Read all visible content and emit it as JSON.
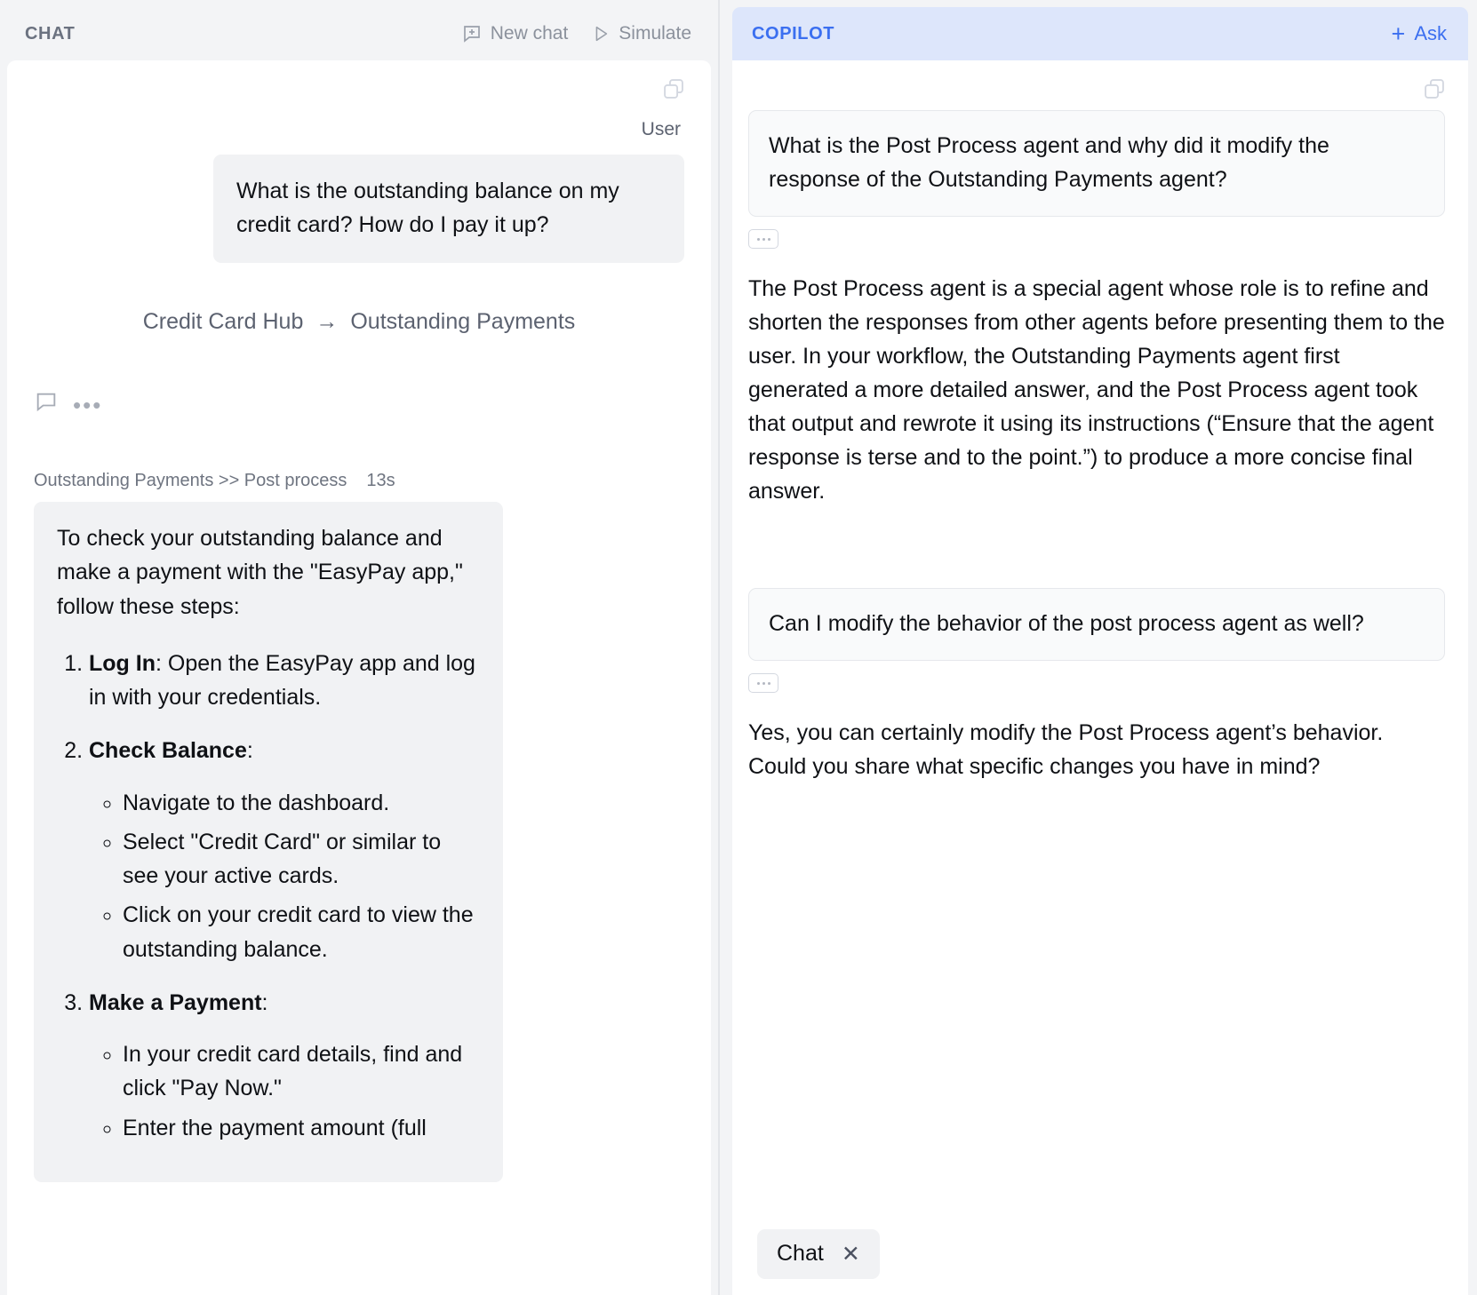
{
  "chat": {
    "title": "CHAT",
    "actions": [
      {
        "label": "New chat",
        "icon": "new-chat-icon"
      },
      {
        "label": "Simulate",
        "icon": "play-icon"
      }
    ],
    "copy_icon": "copy-icon",
    "user_label": "User",
    "user_message": "What is the outstanding balance on my credit card? How do I pay it up?",
    "route": {
      "from": "Credit Card Hub",
      "arrow": "→",
      "to": "Outstanding Payments"
    },
    "tools": {
      "comment_icon": "comment-icon",
      "more_icon": "ellipsis-icon",
      "more_label": "•••"
    },
    "agent_meta": {
      "path": "Outstanding Payments >> Post process",
      "duration": "13s"
    },
    "agent_message": {
      "intro": "To check your outstanding balance and make a payment with the \"EasyPay app,\" follow these steps:",
      "steps": [
        {
          "title": "Log In",
          "title_suffix": ": Open the EasyPay app and log in with your credentials.",
          "bullets": []
        },
        {
          "title": "Check Balance",
          "title_suffix": ":",
          "bullets": [
            "Navigate to the dashboard.",
            "Select \"Credit Card\" or similar to see your active cards.",
            "Click on your credit card to view the outstanding balance."
          ]
        },
        {
          "title": "Make a Payment",
          "title_suffix": ":",
          "bullets": [
            "In your credit card details, find and click \"Pay Now.\"",
            "Enter the payment amount (full"
          ]
        }
      ]
    }
  },
  "copilot": {
    "title": "COPILOT",
    "ask_label": "Ask",
    "ask_plus": "+",
    "copy_icon": "copy-icon",
    "thread": [
      {
        "question": "What is the Post Process agent and why did it modify the response of the Outstanding Payments agent?",
        "answer": "The Post Process agent is a special agent whose role is to refine and shorten the responses from other agents before presenting them to the user. In your workflow, the Outstanding Payments agent first generated a more detailed answer, and the Post Process agent took that output and rewrote it using its instructions (“Ensure that the agent response is terse and to the point.”) to produce a more concise final answer."
      },
      {
        "question": "Can I modify the behavior of the post process agent as well?",
        "answer": "Yes, you can certainly modify the Post Process agent’s behavior. Could you share what specific changes you have in mind?"
      }
    ],
    "footer_tab": {
      "label": "Chat",
      "close": "✕"
    }
  },
  "colors": {
    "accent": "#3b6ff0",
    "copilot_header_bg": "#dde6fb",
    "bubble_bg": "#f1f2f4",
    "panel_bg": "#f3f4f6",
    "muted_text": "#6b7280"
  }
}
